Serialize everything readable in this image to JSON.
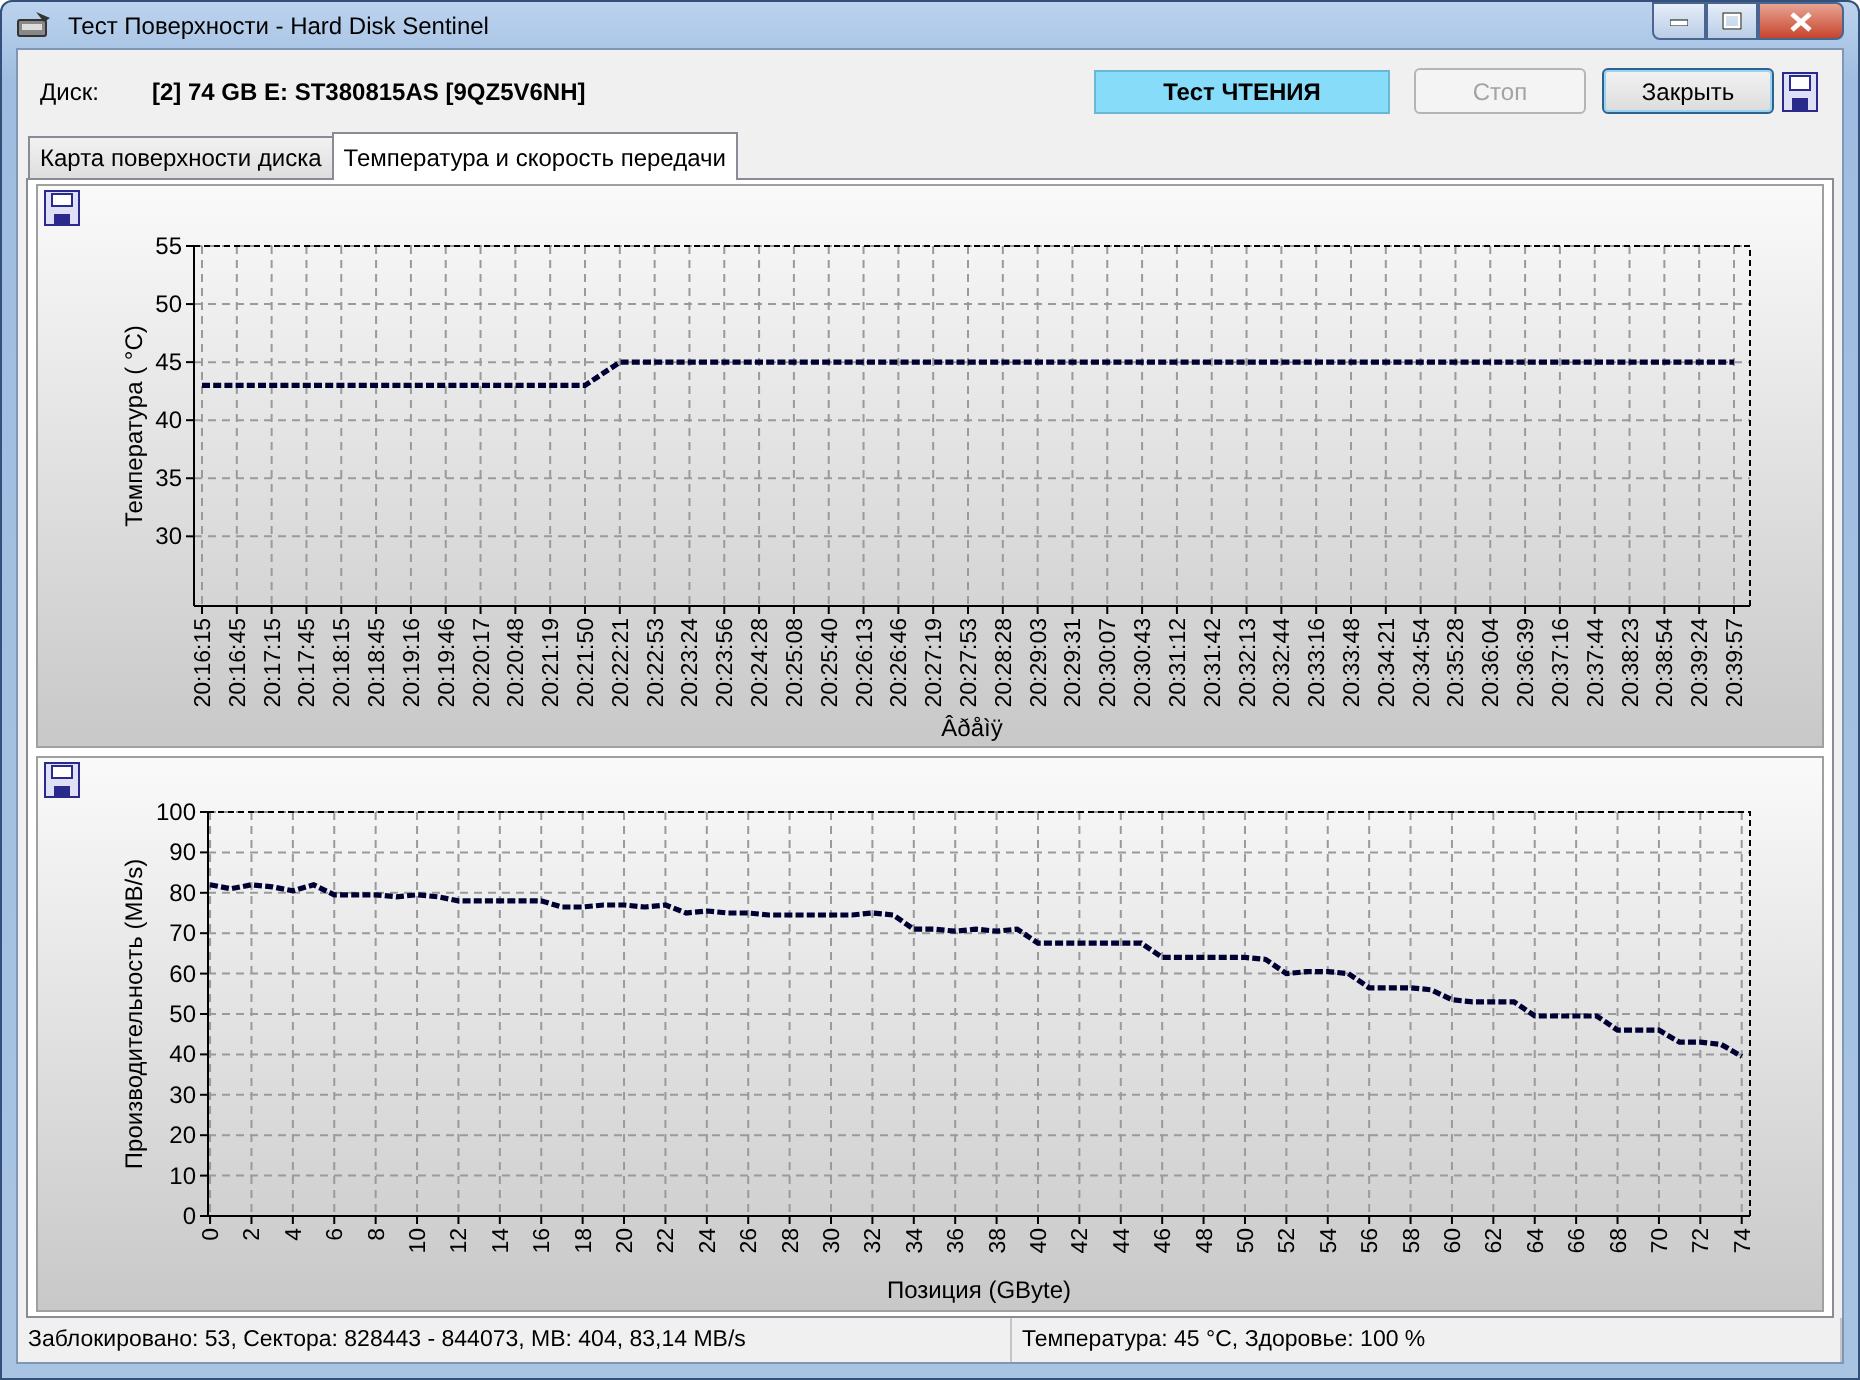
{
  "window": {
    "title": "Тест Поверхности - Hard Disk Sentinel"
  },
  "header": {
    "disk_label": "Диск:",
    "disk_value": "[2] 74 GB E: ST380815AS [9QZ5V6NH]",
    "test_status": "Тест ЧТЕНИЯ",
    "buttons": [
      {
        "label": "Стоп",
        "disabled": true,
        "focused": false
      },
      {
        "label": "Закрыть",
        "disabled": false,
        "focused": true
      }
    ]
  },
  "tabs": [
    {
      "label": "Карта поверхности диска",
      "selected": false
    },
    {
      "label": "Температура и скорость передачи",
      "selected": true
    }
  ],
  "temperature_panel": {
    "chart_data": {
      "type": "line",
      "xlabel": "Âðåìÿ",
      "ylabel": "Температура ( °C)",
      "categories": [
        "20:16:15",
        "20:16:45",
        "20:17:15",
        "20:17:45",
        "20:18:15",
        "20:18:45",
        "20:19:16",
        "20:19:46",
        "20:20:17",
        "20:20:48",
        "20:21:19",
        "20:21:50",
        "20:22:21",
        "20:22:53",
        "20:23:24",
        "20:23:56",
        "20:24:28",
        "20:25:08",
        "20:25:40",
        "20:26:13",
        "20:26:46",
        "20:27:19",
        "20:27:53",
        "20:28:28",
        "20:29:03",
        "20:29:31",
        "20:30:07",
        "20:30:43",
        "20:31:12",
        "20:31:42",
        "20:32:13",
        "20:32:44",
        "20:33:16",
        "20:33:48",
        "20:34:21",
        "20:34:54",
        "20:35:28",
        "20:36:04",
        "20:36:39",
        "20:37:16",
        "20:37:44",
        "20:38:23",
        "20:38:54",
        "20:39:24",
        "20:39:57"
      ],
      "grid": true,
      "series": [
        {
          "color": "#000033",
          "line_style": "dotted",
          "values": [
            43,
            43,
            43,
            43,
            43,
            43,
            43,
            43,
            43,
            43,
            43,
            43,
            45,
            45,
            45,
            45,
            45,
            45,
            45,
            45,
            45,
            45,
            45,
            45,
            45,
            45,
            45,
            45,
            45,
            45,
            45,
            45,
            45,
            45,
            45,
            45,
            45,
            45,
            45,
            45,
            45,
            45,
            45,
            45,
            45
          ]
        }
      ],
      "ylim": [
        24,
        55
      ],
      "yticks": [
        30,
        35,
        40,
        45,
        50,
        55
      ]
    }
  },
  "speed_panel": {
    "chart_data": {
      "type": "line",
      "xlabel": "Позиция (GByte)",
      "ylabel": "Производительность (MB/s)",
      "x": [
        0,
        1,
        2,
        3,
        4,
        5,
        6,
        7,
        8,
        9,
        10,
        11,
        12,
        13,
        14,
        15,
        16,
        17,
        18,
        19,
        20,
        21,
        22,
        23,
        24,
        25,
        26,
        27,
        28,
        29,
        30,
        31,
        32,
        33,
        34,
        35,
        36,
        37,
        38,
        39,
        40,
        41,
        42,
        43,
        44,
        45,
        46,
        47,
        48,
        49,
        50,
        51,
        52,
        53,
        54,
        55,
        56,
        57,
        58,
        59,
        60,
        61,
        62,
        63,
        64,
        65,
        66,
        67,
        68,
        69,
        70,
        71,
        72,
        73,
        74
      ],
      "grid": true,
      "series": [
        {
          "color": "#000033",
          "line_style": "dotted",
          "values": [
            82,
            81,
            82,
            81.5,
            80.5,
            82,
            79.5,
            79.5,
            79.5,
            79,
            79.5,
            79,
            78,
            78,
            78,
            78,
            78,
            76.5,
            76.5,
            77,
            77,
            76.5,
            77,
            75,
            75.5,
            75,
            75,
            74.5,
            74.5,
            74.5,
            74.5,
            74.5,
            75,
            74.5,
            71,
            71,
            70.5,
            71,
            70.5,
            71,
            67.5,
            67.5,
            67.5,
            67.5,
            67.5,
            67.5,
            64,
            64,
            64,
            64,
            64,
            63.5,
            60,
            60.5,
            60.5,
            60,
            56.5,
            56.5,
            56.5,
            56,
            53.5,
            53,
            53,
            53,
            49.5,
            49.5,
            49.5,
            49.5,
            46,
            46,
            46,
            43,
            43,
            42.5,
            39.5
          ]
        }
      ],
      "xlim": [
        -0.1,
        74.4
      ],
      "ylim": [
        0,
        100
      ],
      "xticks": [
        0,
        2,
        4,
        6,
        8,
        10,
        12,
        14,
        16,
        18,
        20,
        22,
        24,
        26,
        28,
        30,
        32,
        34,
        36,
        38,
        40,
        42,
        44,
        46,
        48,
        50,
        52,
        54,
        56,
        58,
        60,
        62,
        64,
        66,
        68,
        70,
        72,
        74
      ],
      "yticks": [
        0,
        10,
        20,
        30,
        40,
        50,
        60,
        70,
        80,
        90,
        100
      ]
    }
  },
  "status_bar": [
    "Заблокировано: 53, Сектора: 828443 - 844073, MB: 404, 83,14 MB/s",
    "Температура: 45  °C,  Здоровье: 100 %"
  ]
}
